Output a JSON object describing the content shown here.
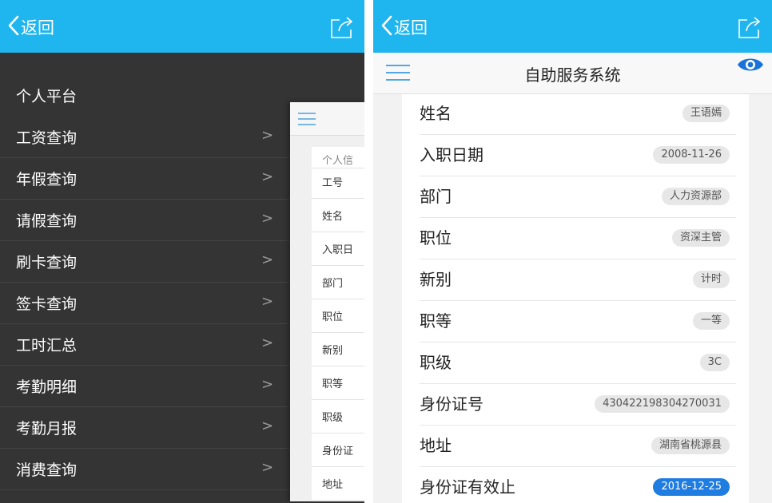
{
  "left": {
    "back_label": "返回",
    "menu_header": "个人平台",
    "menu_items": [
      {
        "label": "工资查询"
      },
      {
        "label": "年假查询"
      },
      {
        "label": "请假查询"
      },
      {
        "label": "刷卡查询"
      },
      {
        "label": "签卡查询"
      },
      {
        "label": "工时汇总"
      },
      {
        "label": "考勤明细"
      },
      {
        "label": "考勤月报"
      },
      {
        "label": "消费查询"
      }
    ],
    "chevron": ">",
    "peek_rows": [
      "个人信",
      "工号",
      "姓名",
      "入职日",
      "部门",
      "职位",
      "新别",
      "职等",
      "职级",
      "身份证",
      "地址"
    ]
  },
  "right": {
    "back_label": "返回",
    "title": "自助服务系统",
    "fields": [
      {
        "label": "姓名",
        "value": "王语嫣"
      },
      {
        "label": "入职日期",
        "value": "2008-11-26"
      },
      {
        "label": "部门",
        "value": "人力资源部"
      },
      {
        "label": "职位",
        "value": "资深主管"
      },
      {
        "label": "新别",
        "value": "计时"
      },
      {
        "label": "职等",
        "value": "一等"
      },
      {
        "label": "职级",
        "value": "3C"
      },
      {
        "label": "身份证号",
        "value": "430422198304270031"
      },
      {
        "label": "地址",
        "value": "湖南省桃源县"
      },
      {
        "label": "身份证有效止",
        "value": "2016-12-25"
      }
    ]
  },
  "colors": {
    "topbar": "#1fb5ee",
    "drawer": "#343434",
    "badge_highlight": "#1f7ce0",
    "eye_icon": "#1a73d9"
  }
}
